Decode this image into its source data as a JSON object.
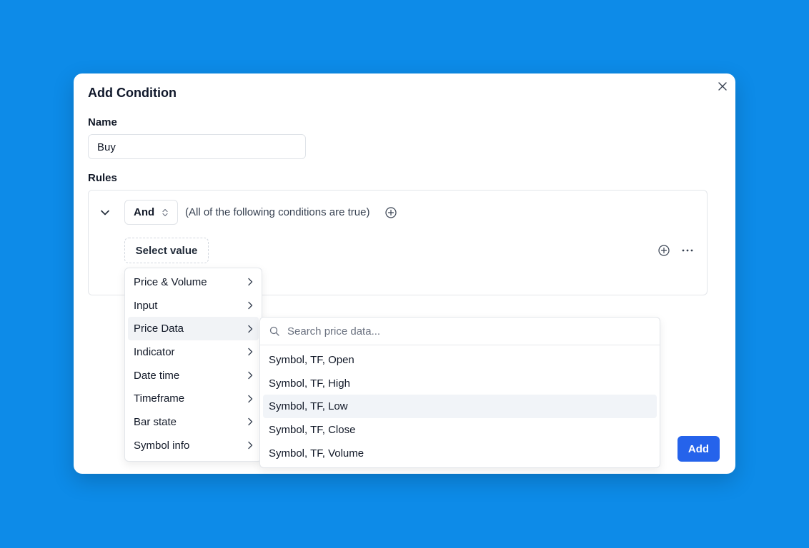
{
  "dialog": {
    "title": "Add Condition",
    "name_label": "Name",
    "name_value": "Buy",
    "rules_label": "Rules",
    "add_label": "Add"
  },
  "rule_group": {
    "operator": "And",
    "description": "(All of the following conditions are true)",
    "select_value": "Select value"
  },
  "menu": {
    "items": [
      {
        "label": "Price & Volume"
      },
      {
        "label": "Input"
      },
      {
        "label": "Price Data"
      },
      {
        "label": "Indicator"
      },
      {
        "label": "Date time"
      },
      {
        "label": "Timeframe"
      },
      {
        "label": "Bar state"
      },
      {
        "label": "Symbol info"
      }
    ],
    "active_index": 2
  },
  "submenu": {
    "search_placeholder": "Search price data...",
    "items": [
      {
        "label": "Symbol, TF, Open"
      },
      {
        "label": "Symbol, TF, High"
      },
      {
        "label": "Symbol, TF, Low"
      },
      {
        "label": "Symbol, TF, Close"
      },
      {
        "label": "Symbol, TF, Volume"
      }
    ],
    "active_index": 2
  },
  "colors": {
    "background": "#0d8be8",
    "accent": "#2563eb"
  }
}
